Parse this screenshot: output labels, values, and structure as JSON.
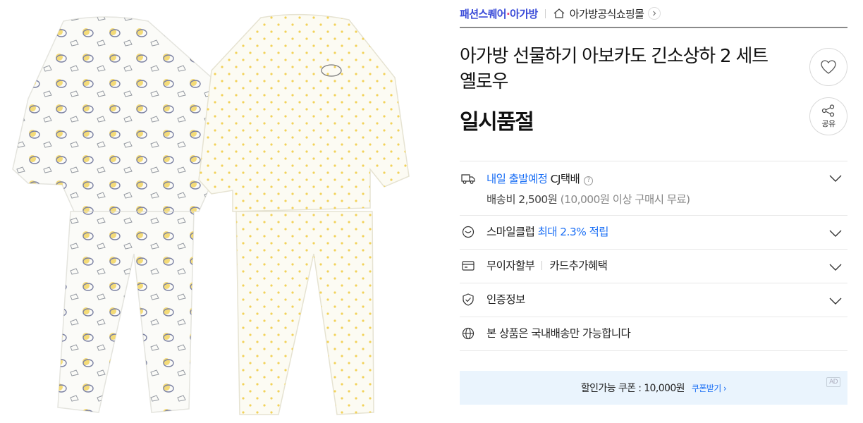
{
  "breadcrumb": {
    "brand_part1": "패션스퀘어",
    "brand_part2": "아가방",
    "shop_name": "아가방공식쇼핑몰"
  },
  "product": {
    "title": "아가방 선물하기 아보카도 긴소상하 2 세트 옐로우",
    "status": "일시품절"
  },
  "actions": {
    "share_label": "공유"
  },
  "shipping": {
    "eta": "내일 출발예정",
    "carrier": "CJ택배",
    "fee": "배송비 2,500원",
    "free_condition": "(10,000원 이상 구매시 무료)"
  },
  "smile_club": {
    "label": "스마일클럽",
    "benefit": "최대 2.3% 적립"
  },
  "installment": {
    "label": "무이자할부",
    "card_benefit": "카드추가혜택"
  },
  "certification": {
    "label": "인증정보"
  },
  "delivery_notice": {
    "label": "본 상품은 국내배송만 가능합니다"
  },
  "coupon": {
    "text": "할인가능 쿠폰 : 10,000원",
    "link": "쿠폰받기",
    "ad_badge": "AD"
  },
  "colors": {
    "brand_blue": "#3a4bd8",
    "accent_blue": "#1b6ff5",
    "coupon_bg": "#eaf4fd"
  },
  "icons": [
    "home-icon",
    "chevron-right-icon",
    "heart-icon",
    "share-icon",
    "truck-icon",
    "smile-icon",
    "card-icon",
    "shield-check-icon",
    "globe-icon",
    "chevron-down-icon"
  ]
}
